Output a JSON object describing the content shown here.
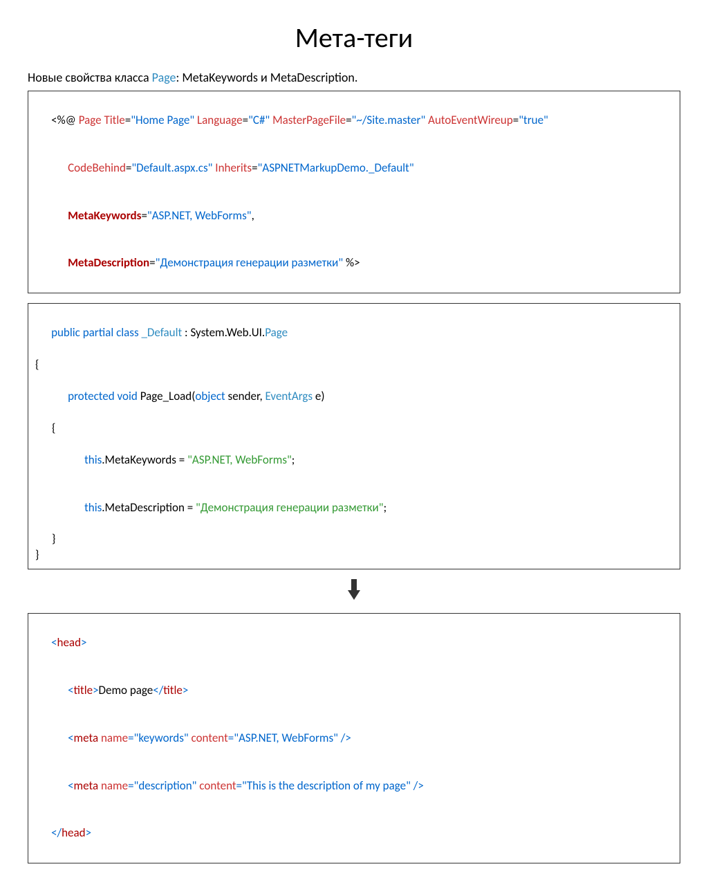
{
  "title": "Мета-теги",
  "subtitle_prefix": "Новые свойства класса ",
  "subtitle_page": "Page",
  "subtitle_suffix": ": MetaKeywords и MetaDescription.",
  "box1": {
    "l1a": "<%@",
    "l1b": " Page",
    "l1c": " Title",
    "l1d": "=",
    "l1e": "\"Home Page\"",
    "l1f": " Language",
    "l1g": "=",
    "l1h": "\"C#\"",
    "l1i": " MasterPageFile",
    "l1j": "=",
    "l1k": "\"~/Site.master\"",
    "l1l": " AutoEventWireup",
    "l1m": "=",
    "l1n": "\"true\"",
    "l2a": "CodeBehind",
    "l2b": "=",
    "l2c": "\"Default.aspx.cs\"",
    "l2d": " Inherits",
    "l2e": "=",
    "l2f": "\"ASPNETMarkupDemo._Default\"",
    "l3a": "MetaKeywords",
    "l3b": "=",
    "l3c": "\"ASP.NET, WebForms\"",
    "l3d": ",",
    "l4a": "MetaDescription",
    "l4b": "=",
    "l4c": "\"Демонстрация генерации разметки\"",
    "l4d": " %>"
  },
  "box2": {
    "l1a": "public",
    "l1b": " partial",
    "l1c": " class",
    "l1d": " _Default",
    "l1e": " : System.Web.UI.",
    "l1f": "Page",
    "l2": "{",
    "l3a": "protected",
    "l3b": " void",
    "l3c": " Page_Load(",
    "l3d": "object",
    "l3e": " sender, ",
    "l3f": "EventArgs",
    "l3g": " e)",
    "l4": "{",
    "l5a": "this",
    "l5b": ".MetaKeywords = ",
    "l5c": "\"ASP.NET, WebForms\"",
    "l5d": ";",
    "l6a": "this",
    "l6b": ".MetaDescription = ",
    "l6c": "\"Демонстрация генерации разметки\"",
    "l6d": ";",
    "l7": "}",
    "l8": "}"
  },
  "box3": {
    "l1a": "<",
    "l1b": "head",
    "l1c": ">",
    "l2a": "<",
    "l2b": "title",
    "l2c": ">",
    "l2d": "Demo page",
    "l2e": "</",
    "l2f": "title",
    "l2g": ">",
    "l3a": "<",
    "l3b": "meta",
    "l3c": " name",
    "l3d": "=",
    "l3e": "\"keywords\"",
    "l3f": " content",
    "l3g": "=",
    "l3h": "\"ASP.NET, WebForms\"",
    "l3i": " />",
    "l4a": "<",
    "l4b": "meta",
    "l4c": " name",
    "l4d": "=",
    "l4e": "\"description\"",
    "l4f": " content",
    "l4g": "=",
    "l4h": "\"This is the description of my page\"",
    "l4i": " />",
    "l5a": "</",
    "l5b": "head",
    "l5c": ">"
  }
}
